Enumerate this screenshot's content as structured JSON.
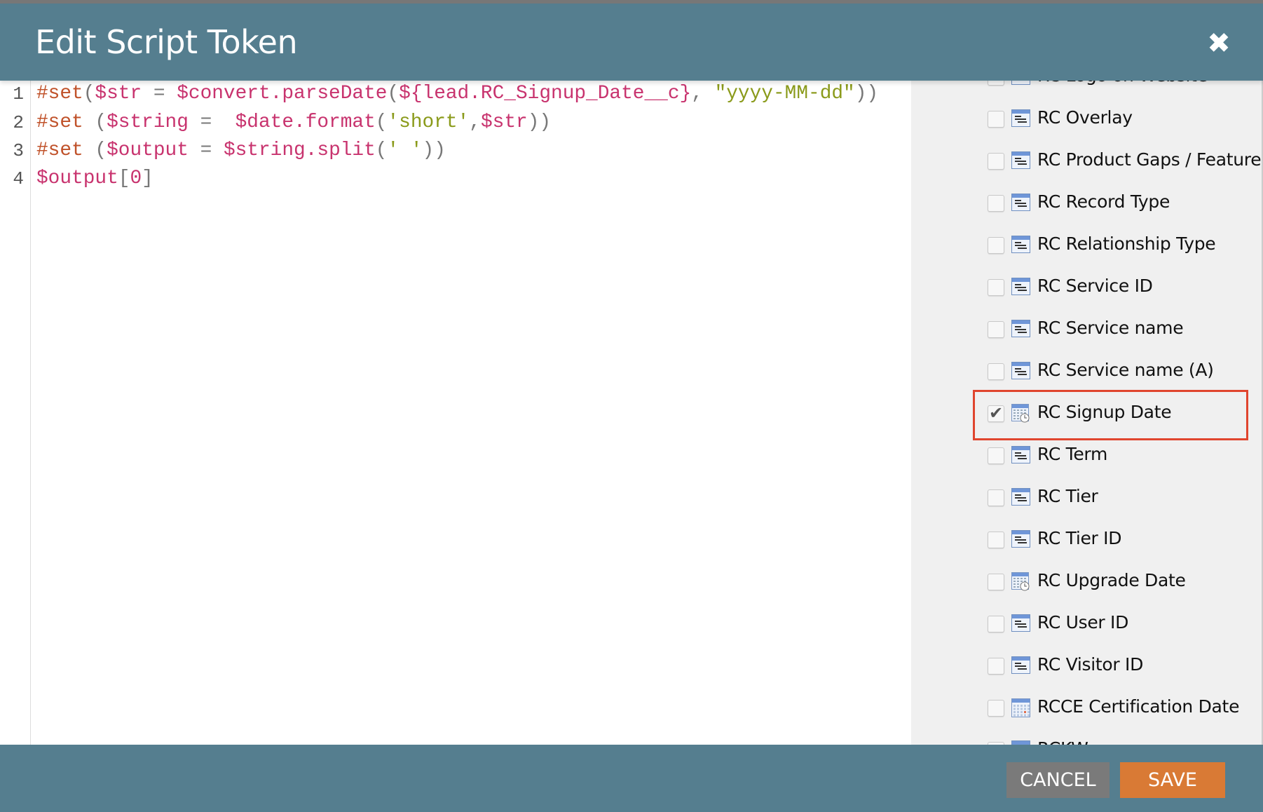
{
  "dialog": {
    "title": "Edit Script Token",
    "close_icon": "close-icon"
  },
  "editor": {
    "line_numbers": [
      "1",
      "2",
      "3",
      "4"
    ],
    "lines": [
      [
        {
          "t": "kw",
          "v": "#set"
        },
        {
          "t": "pn",
          "v": "("
        },
        {
          "t": "vr",
          "v": "$str"
        },
        {
          "t": "pn",
          "v": " = "
        },
        {
          "t": "vr",
          "v": "$convert.parseDate"
        },
        {
          "t": "pn",
          "v": "("
        },
        {
          "t": "vr",
          "v": "${lead.RC_Signup_Date__c}"
        },
        {
          "t": "pn",
          "v": ", "
        },
        {
          "t": "st",
          "v": "\"yyyy-MM-dd\""
        },
        {
          "t": "pn",
          "v": "))"
        }
      ],
      [
        {
          "t": "kw",
          "v": "#set"
        },
        {
          "t": "pn",
          "v": " ("
        },
        {
          "t": "vr",
          "v": "$string"
        },
        {
          "t": "pn",
          "v": " =  "
        },
        {
          "t": "vr",
          "v": "$date.format"
        },
        {
          "t": "pn",
          "v": "("
        },
        {
          "t": "st",
          "v": "'short'"
        },
        {
          "t": "pn",
          "v": ","
        },
        {
          "t": "vr",
          "v": "$str"
        },
        {
          "t": "pn",
          "v": "))"
        }
      ],
      [
        {
          "t": "kw",
          "v": "#set"
        },
        {
          "t": "pn",
          "v": " ("
        },
        {
          "t": "vr",
          "v": "$output"
        },
        {
          "t": "pn",
          "v": " = "
        },
        {
          "t": "vr",
          "v": "$string.split"
        },
        {
          "t": "pn",
          "v": "("
        },
        {
          "t": "st",
          "v": "' '"
        },
        {
          "t": "pn",
          "v": "))"
        }
      ],
      [
        {
          "t": "vr",
          "v": "$output"
        },
        {
          "t": "pn",
          "v": "["
        },
        {
          "t": "vr",
          "v": "0"
        },
        {
          "t": "pn",
          "v": "]"
        }
      ]
    ]
  },
  "fields": [
    {
      "label": "RC Logo on Website",
      "icon": "text-field-icon",
      "checked": false
    },
    {
      "label": "RC Overlay",
      "icon": "text-field-icon",
      "checked": false
    },
    {
      "label": "RC Product Gaps / Features",
      "icon": "text-field-icon",
      "checked": false
    },
    {
      "label": "RC Record Type",
      "icon": "text-field-icon",
      "checked": false
    },
    {
      "label": "RC Relationship Type",
      "icon": "text-field-icon",
      "checked": false
    },
    {
      "label": "RC Service ID",
      "icon": "text-field-icon",
      "checked": false
    },
    {
      "label": "RC Service name",
      "icon": "text-field-icon",
      "checked": false
    },
    {
      "label": "RC Service name (A)",
      "icon": "text-field-icon",
      "checked": false
    },
    {
      "label": "RC Signup Date",
      "icon": "datetime-field-icon",
      "checked": true,
      "highlighted": true
    },
    {
      "label": "RC Term",
      "icon": "text-field-icon",
      "checked": false
    },
    {
      "label": "RC Tier",
      "icon": "text-field-icon",
      "checked": false
    },
    {
      "label": "RC Tier ID",
      "icon": "text-field-icon",
      "checked": false
    },
    {
      "label": "RC Upgrade Date",
      "icon": "datetime-field-icon",
      "checked": false
    },
    {
      "label": "RC User ID",
      "icon": "text-field-icon",
      "checked": false
    },
    {
      "label": "RC Visitor ID",
      "icon": "text-field-icon",
      "checked": false
    },
    {
      "label": "RCCE Certification Date",
      "icon": "calendar-field-icon",
      "checked": false
    },
    {
      "label": "RCKW",
      "icon": "text-field-icon",
      "checked": false
    }
  ],
  "footer": {
    "cancel_label": "CANCEL",
    "save_label": "SAVE"
  },
  "colors": {
    "header": "#557e8f",
    "save": "#d97a35",
    "cancel": "#7a7a7a",
    "highlight": "#e0452e"
  }
}
